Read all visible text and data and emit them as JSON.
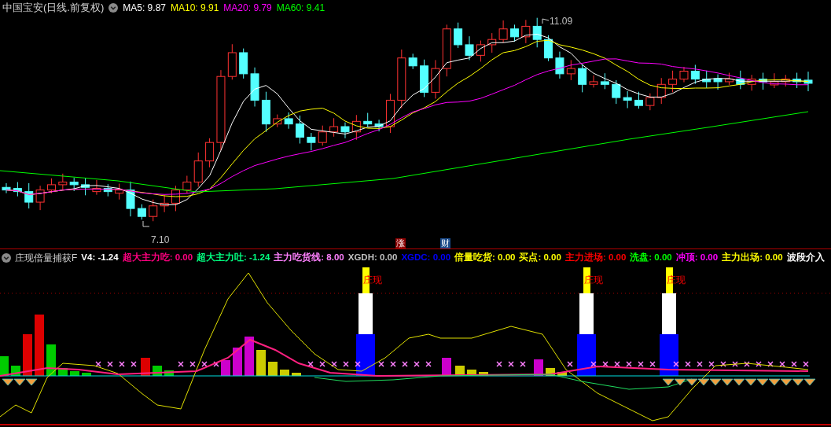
{
  "main_chart": {
    "title": "中国宝安(日线.前复权)",
    "legend": [
      {
        "label": "MA5: 9.87",
        "color": "#ffffff"
      },
      {
        "label": "MA10: 9.91",
        "color": "#ffff00"
      },
      {
        "label": "MA20: 9.79",
        "color": "#ff00ff"
      },
      {
        "label": "MA60: 9.41",
        "color": "#00ff00"
      }
    ],
    "high_label": "11.09",
    "low_label": "7.10",
    "event_markers": [
      {
        "text": "涨",
        "color": "#8b0000"
      },
      {
        "text": "财",
        "color": "#1a4a8a"
      }
    ]
  },
  "indicator": {
    "title": "庄现倍量捕获F",
    "values": [
      {
        "label": "V4: -1.24",
        "color": "#ffffff"
      },
      {
        "label": "超大主力吃: 0.00",
        "color": "#ff0080"
      },
      {
        "label": "超大主力吐: -1.24",
        "color": "#00ff80"
      },
      {
        "label": "主力吃货线: 8.00",
        "color": "#ff80ff"
      },
      {
        "label": "XGDH: 0.00",
        "color": "#c0c0c0"
      },
      {
        "label": "XGDC: 0.00",
        "color": "#0000ff"
      },
      {
        "label": "倍量吃货: 0.00",
        "color": "#ffff00"
      },
      {
        "label": "买点: 0.00",
        "color": "#ffff00"
      },
      {
        "label": "主力进场: 0.00",
        "color": "#ff0000"
      },
      {
        "label": "洗盘: 0.00",
        "color": "#00ff00"
      },
      {
        "label": "冲顶: 0.00",
        "color": "#ff00ff"
      },
      {
        "label": "主力出场: 0.00",
        "color": "#ffff00"
      },
      {
        "label": "波段介入",
        "color": "#ffffff"
      }
    ],
    "signal_labels": [
      "庄现",
      "庄现",
      "庄现"
    ]
  }
}
